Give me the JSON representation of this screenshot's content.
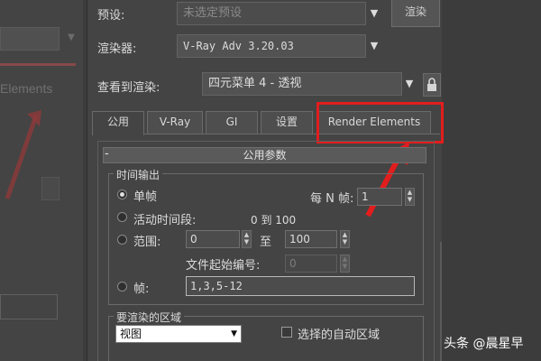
{
  "background_window": {
    "tab_fragment": "Elements"
  },
  "toolbar": {
    "render_button_label": "渲染"
  },
  "rows": {
    "preset_label": "预设:",
    "preset_value": "未选定预设",
    "renderer_label": "渲染器:",
    "renderer_value": "V-Ray Adv 3.20.03",
    "view_label": "查看到渲染:",
    "view_value": "四元菜单 4 - 透视"
  },
  "tabs": [
    {
      "label": "公用",
      "active": true
    },
    {
      "label": "V-Ray",
      "active": false
    },
    {
      "label": "GI",
      "active": false
    },
    {
      "label": "设置",
      "active": false
    },
    {
      "label": "Render Elements",
      "active": false,
      "highlighted": true
    }
  ],
  "rollout": {
    "toggle": "-",
    "title": "公用参数"
  },
  "time_output": {
    "title": "时间输出",
    "single_label": "单帧",
    "every_n_label": "每 N 帧:",
    "every_n_value": "1",
    "active_segment_label": "活动时间段:",
    "active_segment_value": "0 到 100",
    "range_label": "范围:",
    "range_start": "0",
    "range_to": "至",
    "range_end": "100",
    "file_number_label": "文件起始编号:",
    "file_number_value": "0",
    "frames_label": "帧:",
    "frames_value": "1,3,5-12",
    "selected_option": "single"
  },
  "render_area": {
    "title": "要渲染的区域",
    "mode_value": "视图",
    "auto_region_label": "选择的自动区域",
    "auto_region_checked": false
  },
  "watermark": {
    "text": "头条 @晨星早"
  },
  "colors": {
    "annotation_red": "#e21d1d",
    "panel_bg": "#444444"
  }
}
